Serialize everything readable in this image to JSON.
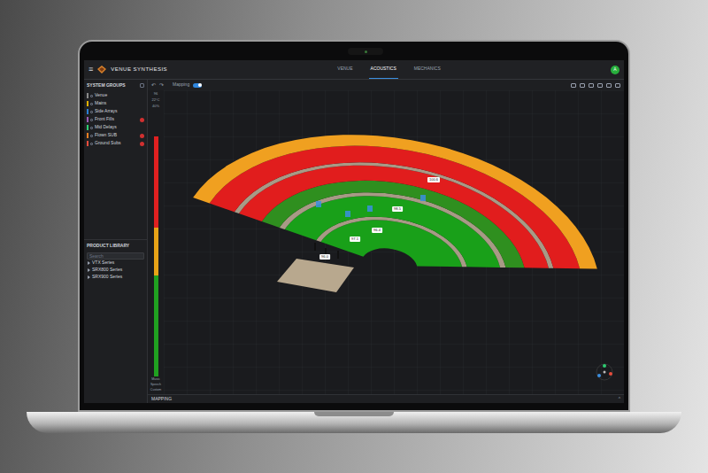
{
  "app": {
    "menu_icon": "≡",
    "title": "VENUE SYNTHESIS",
    "avatar": "A"
  },
  "tabs": [
    {
      "label": "VENUE",
      "selected": false
    },
    {
      "label": "ACOUSTICS",
      "selected": true
    },
    {
      "label": "MECHANICS",
      "selected": false
    }
  ],
  "system_groups": {
    "title": "SYSTEM GROUPS",
    "items": [
      {
        "label": "Venue",
        "color": "#8a8a8a",
        "alert": false
      },
      {
        "label": "Mains",
        "color": "#e0b000",
        "alert": false
      },
      {
        "label": "Side Arrays",
        "color": "#2a7fd4",
        "alert": false
      },
      {
        "label": "Front Fills",
        "color": "#9b59b6",
        "alert": true
      },
      {
        "label": "Mid Delays",
        "color": "#2ecc71",
        "alert": false
      },
      {
        "label": "Flown SUB",
        "color": "#e67e22",
        "alert": true
      },
      {
        "label": "Ground Subs",
        "color": "#e74c3c",
        "alert": true
      }
    ]
  },
  "readings": [
    "96",
    "22°C",
    "40%"
  ],
  "product_library": {
    "title": "PRODUCT LIBRARY",
    "search_placeholder": "Search",
    "items": [
      "VTX Series",
      "SRX800 Series",
      "SRX900 Series"
    ]
  },
  "toolbar": {
    "undo": "↶",
    "redo": "↷",
    "mapping": {
      "label": "Mapping",
      "on": true
    }
  },
  "meter": {
    "segments": [
      {
        "color": "#e02020",
        "level": 0.38
      },
      {
        "color": "#e8a317",
        "level": 0.2
      },
      {
        "color": "#20a020",
        "level": 0.42
      }
    ],
    "labels": [
      "Music",
      "Speech",
      "Custom"
    ]
  },
  "map": {
    "zones": [
      {
        "color": "#19a019"
      },
      {
        "color": "#a89a86"
      },
      {
        "color": "#19a019"
      },
      {
        "color": "#a89a86"
      },
      {
        "color": "#2f8f1f"
      },
      {
        "color": "#e11d1d"
      },
      {
        "color": "#a89a86"
      },
      {
        "color": "#e11d1d"
      },
      {
        "color": "#f0a020"
      }
    ],
    "labels": [
      "100.6",
      "98.5",
      "96.4",
      "97.1",
      "96.0"
    ]
  },
  "bottom_panel": {
    "title": "MAPPING",
    "collapse": "^"
  }
}
